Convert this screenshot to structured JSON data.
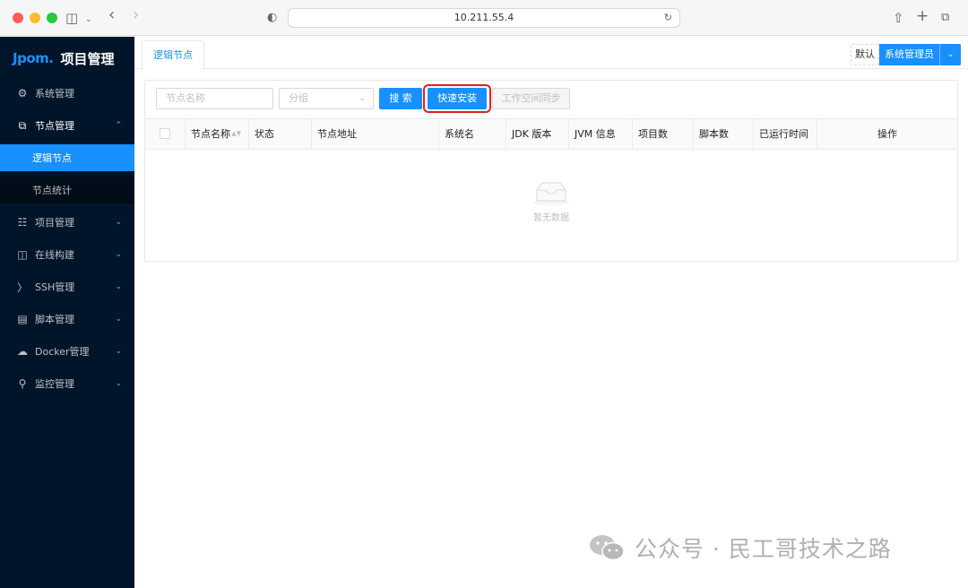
{
  "browser": {
    "url": "10.211.55.4"
  },
  "sidebar": {
    "logo_mark": "Jpom.",
    "logo_title": "项目管理",
    "items": [
      {
        "label": "系统管理",
        "icon": "gear-icon",
        "expandable": false
      },
      {
        "label": "节点管理",
        "icon": "node-icon",
        "expandable": true,
        "open": true
      },
      {
        "label": "项目管理",
        "icon": "sitemap-icon",
        "expandable": true
      },
      {
        "label": "在线构建",
        "icon": "build-icon",
        "expandable": true
      },
      {
        "label": "SSH管理",
        "icon": "terminal-icon",
        "expandable": true
      },
      {
        "label": "脚本管理",
        "icon": "file-icon",
        "expandable": true
      },
      {
        "label": "Docker管理",
        "icon": "cloud-icon",
        "expandable": true
      },
      {
        "label": "监控管理",
        "icon": "monitor-icon",
        "expandable": true
      }
    ],
    "subitems": [
      {
        "label": "逻辑节点",
        "active": true
      },
      {
        "label": "节点统计",
        "active": false
      }
    ]
  },
  "header": {
    "tab": "逻辑节点",
    "default_tag": "默认",
    "user_role": "系统管理员"
  },
  "toolbar": {
    "name_placeholder": "节点名称",
    "group_placeholder": "分组",
    "search_label": "搜 索",
    "quick_install_label": "快速安装",
    "sync_label": "工作空间同步"
  },
  "table": {
    "columns": [
      "节点名称",
      "状态",
      "节点地址",
      "系统名",
      "JDK 版本",
      "JVM 信息",
      "项目数",
      "脚本数",
      "已运行时间",
      "操作"
    ],
    "empty_text": "暂无数据"
  },
  "watermark": {
    "text": "公众号 · 民工哥技术之路"
  },
  "colors": {
    "sidebar_bg": "#001529",
    "primary": "#1890ff",
    "highlight": "#e02020"
  }
}
